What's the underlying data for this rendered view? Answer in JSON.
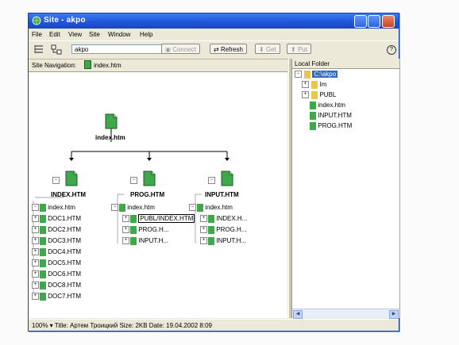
{
  "window": {
    "title": "Site - akpo"
  },
  "menu": [
    "File",
    "Edit",
    "View",
    "Site",
    "Window",
    "Help"
  ],
  "toolbar": {
    "site_value": "akpo",
    "connect": "Connect",
    "refresh": "Refresh",
    "get": "Get",
    "put": "Put",
    "help": "?"
  },
  "nav": {
    "label": "Site Navigation:",
    "file": "index.htm"
  },
  "tree": {
    "root": "index.htm",
    "branches": [
      {
        "label": "INDEX.HTM",
        "children": [
          "index.htm",
          "DOC1.HTM",
          "DOC2.HTM",
          "DOC3.HTM",
          "DOC4.HTM",
          "DOC5.HTM",
          "DOC6.HTM",
          "DOC8.HTM",
          "DOC7.HTM"
        ]
      },
      {
        "label": "PROG.HTM",
        "children": [
          "index.htm",
          "PUBL/INDEX.HTM",
          "PROG.H...",
          "INPUT.H..."
        ]
      },
      {
        "label": "INPUT.HTM",
        "children": [
          "index.htm",
          "INDEX.H...",
          "PROG.H...",
          "INPUT.H..."
        ]
      }
    ]
  },
  "local": {
    "header": "Local Folder",
    "root": "C:\\akpo",
    "items": [
      "Im",
      "PUBL",
      "index.htm",
      "INPUT.HTM",
      "PROG.HTM"
    ]
  },
  "status": "100% ▾ Title: Артем Троицкий  Size: 2KB  Date: 19.04.2002 8:09",
  "colors": {
    "titlebar": "#1f56d9",
    "selection": "#316ac5",
    "icon_green": "#3fa84a"
  }
}
